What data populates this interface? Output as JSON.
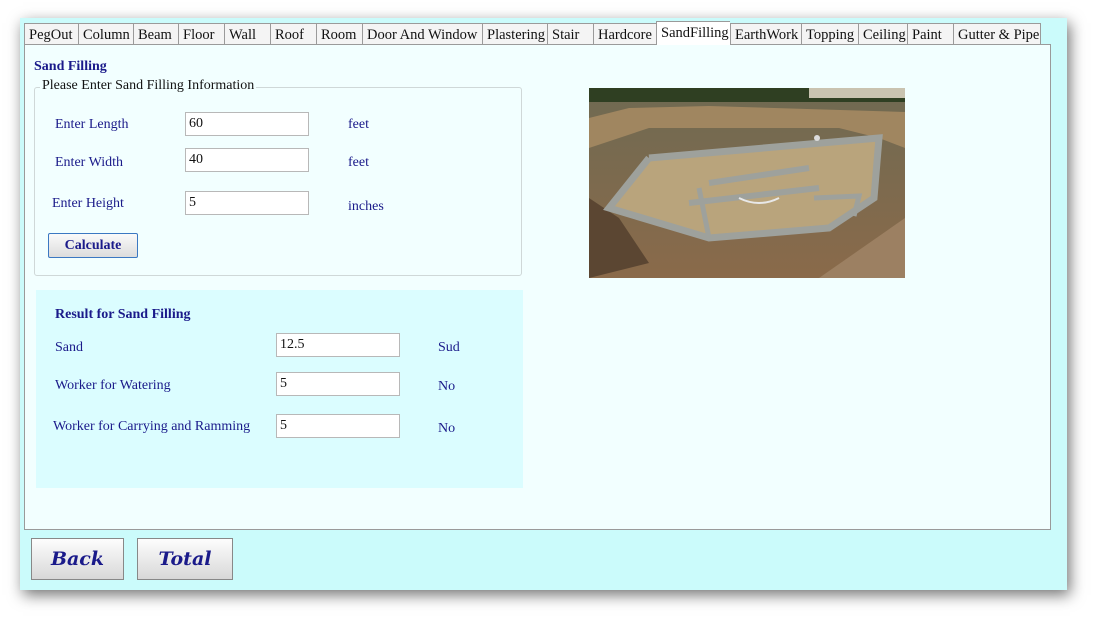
{
  "tabs": [
    "PegOut",
    "Column",
    "Beam",
    "Floor",
    "Wall",
    "Roof",
    "Room",
    "Door And Window",
    "Plastering",
    "Stair",
    "Hardcore",
    "SandFilling",
    "EarthWork",
    "Topping",
    "Ceiling",
    "Paint",
    "Gutter & Pipe"
  ],
  "active_tab": "SandFilling",
  "page_title": "Sand Filling",
  "input_group": {
    "legend": "Please Enter Sand Filling Information",
    "length": {
      "label": "Enter Length",
      "value": "60",
      "unit": "feet"
    },
    "width": {
      "label": "Enter Width",
      "value": "40",
      "unit": "feet"
    },
    "height": {
      "label": "Enter Height",
      "value": "5",
      "unit": "inches"
    },
    "calculate_label": "Calculate"
  },
  "results": {
    "title": "Result for Sand Filling",
    "sand": {
      "label": "Sand",
      "value": "12.5",
      "unit": "Sud"
    },
    "watering": {
      "label": "Worker for Watering",
      "value": "5",
      "unit": "No"
    },
    "ramming": {
      "label": "Worker for Carrying and Ramming",
      "value": "5",
      "unit": "No"
    }
  },
  "footer": {
    "back_label": "Back",
    "total_label": "Total"
  },
  "colors": {
    "window_bg": "#cbfbfb",
    "panel_bg": "#f2ffff",
    "result_bg": "#dbfdff",
    "text_blue": "#1a1a8a",
    "button_border": "#3b78c2"
  }
}
